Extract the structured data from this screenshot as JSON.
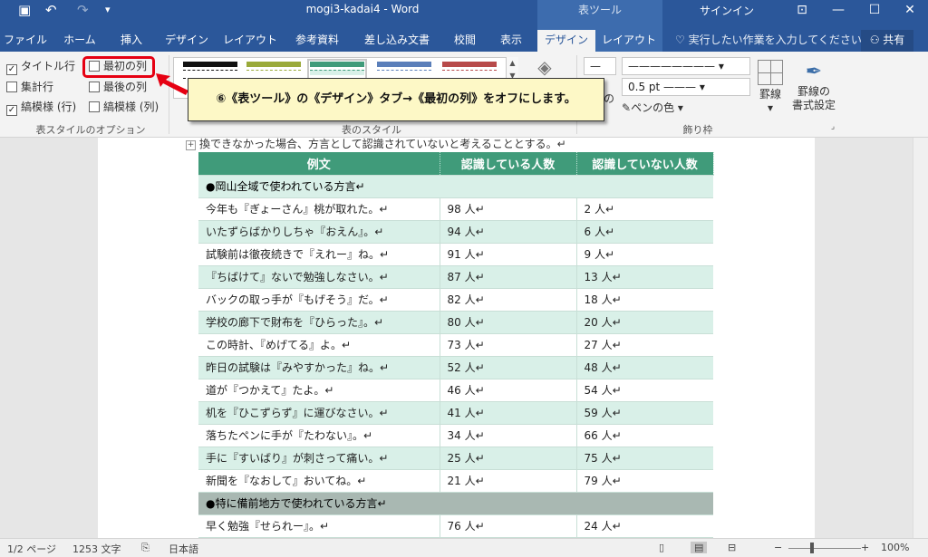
{
  "title_bar": {
    "save_icon": "floppy-icon",
    "undo_label": "↶",
    "redo_label": "↷",
    "qat_more": "▾",
    "document_title": "mogi3-kadai4  -  Word",
    "context_header": "表ツール",
    "sign_in": "サインイン",
    "minimize": "—",
    "maximize": "☐",
    "close": "✕"
  },
  "tabs": {
    "file": "ファイル",
    "home": "ホーム",
    "insert": "挿入",
    "design": "デザイン",
    "layout": "レイアウト",
    "references": "参考資料",
    "mailings": "差し込み文書",
    "review": "校閲",
    "view": "表示",
    "table_design": "デザイン",
    "table_layout": "レイアウト",
    "tell_me": "実行したい作業を入力してください",
    "share": "共有"
  },
  "ribbon": {
    "style_options": {
      "header_row": "タイトル行",
      "total_row": "集計行",
      "banded_rows": "縞模様 (行)",
      "first_column": "最初の列",
      "last_column": "最後の列",
      "banded_columns": "縞模様 (列)",
      "group_label": "表スタイルのオプション"
    },
    "styles_group_label": "表のスタイル",
    "line_weight": "0.5 pt",
    "pen_color": "ペンの色",
    "borders_label": "罫線",
    "border_painter_label": "罫線の\n書式設定",
    "borders_group_label": "飾り枠",
    "shading_label": "の",
    "colors": {
      "ribbon_blue": "#2b579a",
      "header_green": "#409b7a",
      "band_green": "#d9f0e8",
      "highlight_red": "#e60012"
    }
  },
  "callout": {
    "text": "⑥《表ツール》の《デザイン》タブ→《最初の列》をオフにします。"
  },
  "document": {
    "top_text": "換できなかった場合、方言として認識されていないと考えることとする。↵",
    "table": {
      "headers": [
        "例文",
        "認識している人数",
        "認識していない人数"
      ],
      "rows": [
        {
          "type": "section",
          "cells": [
            "●岡山全域で使われている方言↵"
          ]
        },
        {
          "type": "white",
          "cells": [
            "今年も『ぎょーさん』桃が取れた。↵",
            "98 人↵",
            "2 人↵"
          ]
        },
        {
          "type": "band",
          "cells": [
            "いたずらばかりしちゃ『おえん』。↵",
            "94 人↵",
            "6 人↵"
          ]
        },
        {
          "type": "white",
          "cells": [
            "試験前は徹夜続きで『えれー』ね。↵",
            "91 人↵",
            "9 人↵"
          ]
        },
        {
          "type": "band",
          "cells": [
            "『ちばけて』ないで勉強しなさい。↵",
            "87 人↵",
            "13 人↵"
          ]
        },
        {
          "type": "white",
          "cells": [
            "バックの取っ手が『もげそう』だ。↵",
            "82 人↵",
            "18 人↵"
          ]
        },
        {
          "type": "band",
          "cells": [
            "学校の廊下で財布を『ひらった』。↵",
            "80 人↵",
            "20 人↵"
          ]
        },
        {
          "type": "white",
          "cells": [
            "この時計、『めげてる』よ。↵",
            "73 人↵",
            "27 人↵"
          ]
        },
        {
          "type": "band",
          "cells": [
            "昨日の試験は『みやすかった』ね。↵",
            "52 人↵",
            "48 人↵"
          ]
        },
        {
          "type": "white",
          "cells": [
            "道が『つかえて』たよ。↵",
            "46 人↵",
            "54 人↵"
          ]
        },
        {
          "type": "band",
          "cells": [
            "机を『ひこずらず』に運びなさい。↵",
            "41 人↵",
            "59 人↵"
          ]
        },
        {
          "type": "white",
          "cells": [
            "落ちたペンに手が『たわない』。↵",
            "34 人↵",
            "66 人↵"
          ]
        },
        {
          "type": "band",
          "cells": [
            "手に『すいばり』が刺さって痛い。↵",
            "25 人↵",
            "75 人↵"
          ]
        },
        {
          "type": "white",
          "cells": [
            "新聞を『なおして』おいてね。↵",
            "21 人↵",
            "79 人↵"
          ]
        },
        {
          "type": "section2",
          "cells": [
            "●特に備前地方で使われている方言↵"
          ]
        },
        {
          "type": "white",
          "cells": [
            "早く勉強『せられー』。↵",
            "76 人↵",
            "24 人↵"
          ]
        }
      ]
    }
  },
  "status_bar": {
    "page": "1/2 ページ",
    "words": "1253 文字",
    "language": "日本語",
    "zoom": "100%",
    "zoom_minus": "−",
    "zoom_plus": "+"
  }
}
